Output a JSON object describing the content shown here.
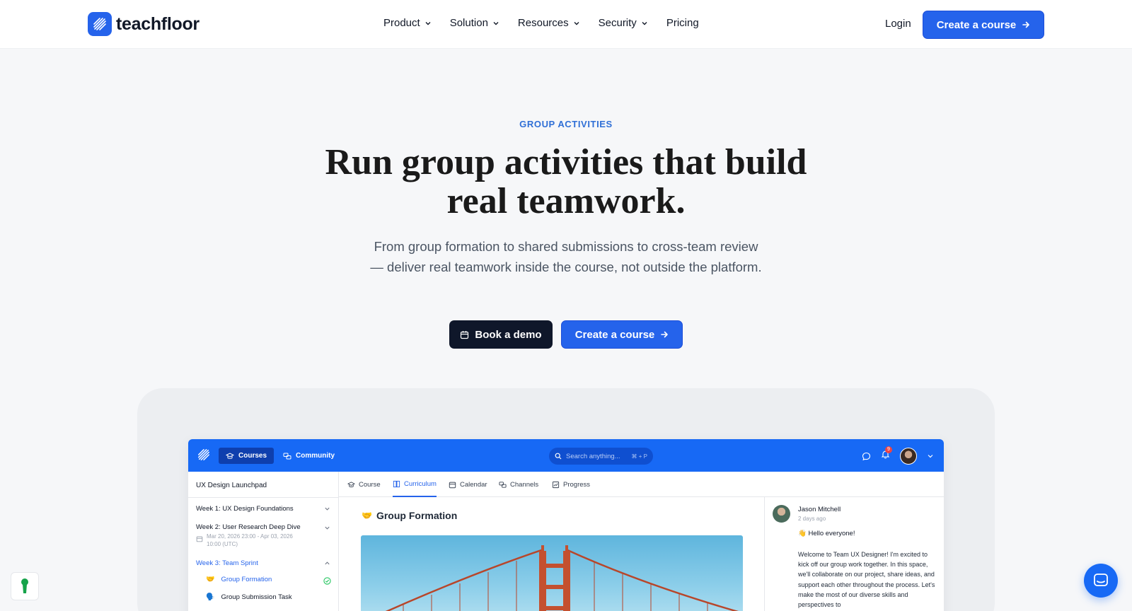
{
  "nav": {
    "brand": "teachfloor",
    "menu": [
      {
        "label": "Product",
        "has_dropdown": true
      },
      {
        "label": "Solution",
        "has_dropdown": true
      },
      {
        "label": "Resources",
        "has_dropdown": true
      },
      {
        "label": "Security",
        "has_dropdown": true
      },
      {
        "label": "Pricing",
        "has_dropdown": false
      }
    ],
    "login": "Login",
    "cta": "Create a course"
  },
  "hero": {
    "eyebrow": "GROUP ACTIVITIES",
    "headline_line1": "Run group activities that build",
    "headline_line2": "real teamwork.",
    "subtitle": "From group formation to shared submissions to cross-team review — deliver real teamwork inside the course, not outside the platform.",
    "demo_button": "Book a demo",
    "cta_button": "Create a course"
  },
  "app": {
    "topbar": {
      "courses_tab": "Courses",
      "community_tab": "Community",
      "search_placeholder": "Search anything...",
      "search_shortcut": "⌘ + P",
      "notification_count": "9"
    },
    "sidebar": {
      "course_title": "UX Design Launchpad",
      "weeks": [
        {
          "label": "Week 1: UX Design Foundations",
          "expanded": false
        },
        {
          "label": "Week 2: User Research Deep Dive",
          "date_line1": "Mar 20, 2026 23:00 - Apr 03, 2026",
          "date_line2": "10:00 (UTC)",
          "expanded": false
        },
        {
          "label": "Week 3: Team Sprint",
          "expanded": true
        }
      ],
      "lessons": [
        {
          "label": "Group Formation",
          "icon": "handshake-icon",
          "active": true,
          "completed": true
        },
        {
          "label": "Group Submission Task",
          "icon": "speaking-head-icon",
          "active": false
        }
      ]
    },
    "tabs": [
      {
        "label": "Course",
        "icon": "graduation-cap-icon"
      },
      {
        "label": "Curriculum",
        "icon": "curriculum-icon",
        "active": true
      },
      {
        "label": "Calendar",
        "icon": "calendar-icon"
      },
      {
        "label": "Channels",
        "icon": "channels-icon"
      },
      {
        "label": "Progress",
        "icon": "progress-icon"
      }
    ],
    "main": {
      "title": "Group Formation",
      "title_emoji": "🤝"
    },
    "chat": {
      "author": "Jason Mitchell",
      "time": "2 days ago",
      "greeting": "👋 Hello everyone!",
      "body": "Welcome to Team UX Designer! I'm excited to kick off our group work together. In this space, we'll collaborate on our project, share ideas, and support each other throughout the process. Let's make the most of our diverse skills and perspectives to"
    }
  },
  "colors": {
    "primary": "#2563eb",
    "app_bar": "#1769f5",
    "dark_button": "#0f172a",
    "eyebrow": "#2f6fd6"
  }
}
